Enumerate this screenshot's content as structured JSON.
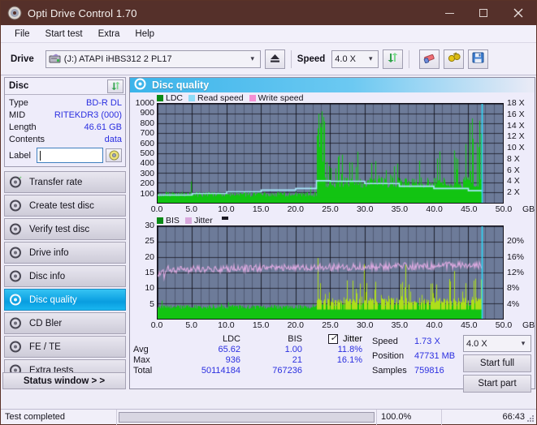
{
  "window": {
    "title": "Opti Drive Control 1.70",
    "app_icon": "disc-icon",
    "minimize": "—",
    "maximize": "□",
    "close": "✕",
    "titlebar_color": "#55302a"
  },
  "menubar": {
    "items": [
      {
        "label": "File"
      },
      {
        "label": "Start test"
      },
      {
        "label": "Extra"
      },
      {
        "label": "Help"
      }
    ]
  },
  "toolbar": {
    "drive_label": "Drive",
    "drive_value": "(J:)   ATAPI iHBS312   2 PL17",
    "drive_icon": "drive-icon",
    "eject_icon": "eject-icon",
    "speed_label": "Speed",
    "speed_value": "4.0 X",
    "refresh_icon": "refresh-icon",
    "eraser_icon": "eraser-icon",
    "scan_icon": "glasses-icon",
    "save_icon": "floppy-save-icon"
  },
  "disc_panel": {
    "title": "Disc",
    "refresh_icon": "refresh-icon",
    "rows": [
      {
        "key": "Type",
        "value": "BD-R DL"
      },
      {
        "key": "MID",
        "value": "RITEKDR3 (000)"
      },
      {
        "key": "Length",
        "value": "46.61 GB"
      },
      {
        "key": "Contents",
        "value": "data"
      }
    ],
    "label_key": "Label",
    "label_value": "",
    "label_placeholder": "",
    "label_icon": "disc-icon"
  },
  "sidebar": {
    "items": [
      {
        "label": "Transfer rate",
        "icon": "disc-icon",
        "active": false
      },
      {
        "label": "Create test disc",
        "icon": "disc-icon",
        "active": false
      },
      {
        "label": "Verify test disc",
        "icon": "disc-icon",
        "active": false
      },
      {
        "label": "Drive info",
        "icon": "disc-icon",
        "active": false
      },
      {
        "label": "Disc info",
        "icon": "disc-icon",
        "active": false
      },
      {
        "label": "Disc quality",
        "icon": "disc-icon",
        "active": true
      },
      {
        "label": "CD Bler",
        "icon": "disc-icon",
        "active": false
      },
      {
        "label": "FE / TE",
        "icon": "disc-icon",
        "active": false
      },
      {
        "label": "Extra tests",
        "icon": "disc-icon",
        "active": false
      }
    ],
    "status_window_button": "Status window > >"
  },
  "panel": {
    "title": "Disc quality",
    "icon": "disc-icon"
  },
  "stats": {
    "col_headers": [
      "LDC",
      "BIS"
    ],
    "jitter_header": "Jitter",
    "jitter_checked": true,
    "rows": [
      {
        "key": "Avg",
        "ldc": "65.62",
        "bis": "1.00",
        "jitter": "11.8%"
      },
      {
        "key": "Max",
        "ldc": "936",
        "bis": "21",
        "jitter": "16.1%"
      },
      {
        "key": "Total",
        "ldc": "50114184",
        "bis": "767236",
        "jitter": ""
      }
    ]
  },
  "readout": {
    "rows": [
      {
        "key": "Speed",
        "value": "1.73 X"
      },
      {
        "key": "Position",
        "value": "47731 MB"
      },
      {
        "key": "Samples",
        "value": "759816"
      }
    ],
    "speed_select": "4.0 X",
    "start_full": "Start full",
    "start_part": "Start part"
  },
  "statusbar": {
    "message": "Test completed",
    "percent_text": "100.0%",
    "percent_value": 100,
    "elapsed": "66:43",
    "progress_color": "#12c412"
  },
  "chart_data": [
    {
      "type": "area",
      "name": "ldc-chart",
      "title": "",
      "xlabel": "GB",
      "ylabel": "LDC",
      "x": [
        0,
        50
      ],
      "xlim": [
        0,
        50
      ],
      "xticks": [
        "0.0",
        "5.0",
        "10.0",
        "15.0",
        "20.0",
        "25.0",
        "30.0",
        "35.0",
        "40.0",
        "45.0",
        "50.0"
      ],
      "xtick_values": [
        0,
        5,
        10,
        15,
        20,
        25,
        30,
        35,
        40,
        45,
        50
      ],
      "ylim": [
        0,
        1000
      ],
      "yticks": [
        "100",
        "200",
        "300",
        "400",
        "500",
        "600",
        "700",
        "800",
        "900",
        "1000"
      ],
      "ytick_values": [
        100,
        200,
        300,
        400,
        500,
        600,
        700,
        800,
        900,
        1000
      ],
      "y2lim": [
        0,
        18
      ],
      "y2ticks": [
        "2 X",
        "4 X",
        "6 X",
        "8 X",
        "10 X",
        "12 X",
        "14 X",
        "16 X",
        "18 X"
      ],
      "y2tick_values": [
        2,
        4,
        6,
        8,
        10,
        12,
        14,
        16,
        18
      ],
      "grid": true,
      "legend": [
        {
          "label": "LDC",
          "color": "#17b817"
        },
        {
          "label": "Read speed",
          "color": "#8fdcf8"
        },
        {
          "label": "Write speed",
          "color": "#f48fd4"
        }
      ],
      "series": [
        {
          "name": "LDC",
          "color": "#17b817",
          "kind": "bars",
          "note": "low baseline ~60-120 from 0-23GB with occasional spikes to 200-480; heavy dense region 23-47GB with baseline ~150-250 and spikes up to 936",
          "baseline_first_half": 90,
          "baseline_second_half": 210,
          "max_value": 936
        },
        {
          "name": "Read speed",
          "color": "#8fdcf8",
          "kind": "step-line",
          "note": "rises in steps from about 1.4X at 0GB to 4.0X at 23GB, then steps down from 4.0X to about 2.0X at 47GB",
          "points": [
            {
              "x": 0,
              "y": 1.4
            },
            {
              "x": 5,
              "y": 1.7
            },
            {
              "x": 10,
              "y": 2.0
            },
            {
              "x": 15,
              "y": 2.3
            },
            {
              "x": 20,
              "y": 2.6
            },
            {
              "x": 23,
              "y": 4.0
            },
            {
              "x": 25,
              "y": 3.9
            },
            {
              "x": 30,
              "y": 3.5
            },
            {
              "x": 35,
              "y": 3.0
            },
            {
              "x": 40,
              "y": 2.6
            },
            {
              "x": 45,
              "y": 2.2
            },
            {
              "x": 47,
              "y": 2.0
            }
          ]
        },
        {
          "name": "Write speed",
          "color": "#f48fd4",
          "kind": "line",
          "points": []
        }
      ],
      "end_marker_x": 47
    },
    {
      "type": "area",
      "name": "bis-jitter-chart",
      "title": "",
      "xlabel": "GB",
      "ylabel": "BIS",
      "xlim": [
        0,
        50
      ],
      "xticks": [
        "0.0",
        "5.0",
        "10.0",
        "15.0",
        "20.0",
        "25.0",
        "30.0",
        "35.0",
        "40.0",
        "45.0",
        "50.0"
      ],
      "xtick_values": [
        0,
        5,
        10,
        15,
        20,
        25,
        30,
        35,
        40,
        45,
        50
      ],
      "ylim": [
        0,
        30
      ],
      "yticks": [
        "5",
        "10",
        "15",
        "20",
        "25",
        "30"
      ],
      "ytick_values": [
        5,
        10,
        15,
        20,
        25,
        30
      ],
      "y2lim": [
        0,
        24
      ],
      "y2ticks": [
        "4%",
        "8%",
        "12%",
        "16%",
        "20%"
      ],
      "y2tick_values": [
        4,
        8,
        12,
        16,
        20
      ],
      "grid": true,
      "legend": [
        {
          "label": "BIS",
          "color": "#17b817"
        },
        {
          "label": "Jitter",
          "color": "#d9a8dd"
        }
      ],
      "series": [
        {
          "name": "BIS",
          "color": "#17b817",
          "kind": "bars",
          "note": "dense bars baseline ~4 from 0-23GB; from 23-47GB baseline ~5-7 with yellow-green spikes up to 21",
          "baseline_first_half": 4,
          "baseline_second_half": 6,
          "max_value": 21
        },
        {
          "name": "Jitter",
          "color": "#d9a8dd",
          "kind": "noisy-line",
          "note": "noisy band averaging about 11.8% (plotted near value 16-17 on left scale), rising slightly toward the end; max 16.1%",
          "avg_percent": 11.8,
          "max_percent": 16.1
        }
      ],
      "end_marker_x": 47
    }
  ]
}
